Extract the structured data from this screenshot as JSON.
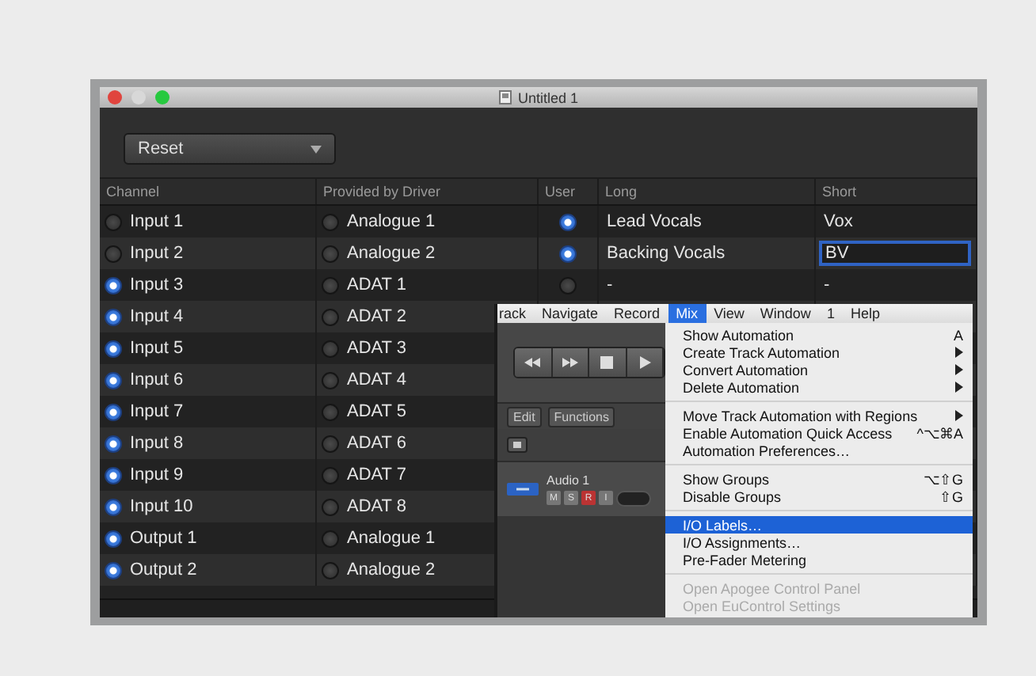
{
  "window": {
    "title": "Untitled 1",
    "controls": [
      {
        "color": "#e0443e"
      },
      {
        "color": "#d8d8d8"
      },
      {
        "color": "#27c93f"
      }
    ]
  },
  "toolbar": {
    "preset": "Reset"
  },
  "table": {
    "columns": [
      "Channel",
      "Provided by Driver",
      "User",
      "Long",
      "Short"
    ],
    "rows": [
      {
        "channel": "Input 1",
        "channel_selected": false,
        "driver": "Analogue 1",
        "driver_selected": false,
        "user_selected": true,
        "long": "Lead Vocals",
        "short": "Vox",
        "editing": false
      },
      {
        "channel": "Input 2",
        "channel_selected": false,
        "driver": "Analogue 2",
        "driver_selected": false,
        "user_selected": true,
        "long": "Backing Vocals",
        "short": "BV",
        "editing": true
      },
      {
        "channel": "Input 3",
        "channel_selected": true,
        "driver": "ADAT 1",
        "driver_selected": false,
        "user_selected": false,
        "long": "-",
        "short": "-",
        "editing": false
      },
      {
        "channel": "Input 4",
        "channel_selected": true,
        "driver": "ADAT 2",
        "driver_selected": false
      },
      {
        "channel": "Input 5",
        "channel_selected": true,
        "driver": "ADAT 3",
        "driver_selected": false
      },
      {
        "channel": "Input 6",
        "channel_selected": true,
        "driver": "ADAT 4",
        "driver_selected": false
      },
      {
        "channel": "Input 7",
        "channel_selected": true,
        "driver": "ADAT 5",
        "driver_selected": false
      },
      {
        "channel": "Input 8",
        "channel_selected": true,
        "driver": "ADAT 6",
        "driver_selected": false
      },
      {
        "channel": "Input 9",
        "channel_selected": true,
        "driver": "ADAT 7",
        "driver_selected": false
      },
      {
        "channel": "Input 10",
        "channel_selected": true,
        "driver": "ADAT 8",
        "driver_selected": false
      },
      {
        "channel": "Output 1",
        "channel_selected": true,
        "driver": "Analogue 1",
        "driver_selected": false
      },
      {
        "channel": "Output 2",
        "channel_selected": true,
        "driver": "Analogue 2",
        "driver_selected": false
      }
    ]
  },
  "logic": {
    "menubar": [
      {
        "label": "rack",
        "selected": false
      },
      {
        "label": "Navigate",
        "selected": false
      },
      {
        "label": "Record",
        "selected": false
      },
      {
        "label": "Mix",
        "selected": true
      },
      {
        "label": "View",
        "selected": false
      },
      {
        "label": "Window",
        "selected": false
      },
      {
        "label": "1",
        "selected": false
      },
      {
        "label": "Help",
        "selected": false
      }
    ],
    "edit_menu": "Edit",
    "functions_menu": "Functions",
    "track": {
      "name": "Audio 1",
      "buttons": [
        "M",
        "S",
        "R",
        "I"
      ]
    },
    "menu": [
      {
        "kind": "item",
        "label": "Show Automation",
        "shortcut": "A",
        "disabled": false,
        "selected": false
      },
      {
        "kind": "submenu",
        "label": "Create Track Automation",
        "disabled": false,
        "selected": false
      },
      {
        "kind": "submenu",
        "label": "Convert Automation",
        "disabled": false,
        "selected": false
      },
      {
        "kind": "submenu",
        "label": "Delete Automation",
        "disabled": false,
        "selected": false
      },
      {
        "kind": "separator"
      },
      {
        "kind": "submenu",
        "label": "Move Track Automation with Regions",
        "disabled": false,
        "selected": false
      },
      {
        "kind": "item",
        "label": "Enable Automation Quick Access",
        "shortcut": "^⌥⌘A",
        "disabled": false,
        "selected": false
      },
      {
        "kind": "item",
        "label": "Automation Preferences…",
        "disabled": false,
        "selected": false
      },
      {
        "kind": "separator"
      },
      {
        "kind": "item",
        "label": "Show Groups",
        "shortcut": "⌥⇧G",
        "disabled": false,
        "selected": false
      },
      {
        "kind": "item",
        "label": "Disable Groups",
        "shortcut": "⇧G",
        "disabled": false,
        "selected": false
      },
      {
        "kind": "separator"
      },
      {
        "kind": "item",
        "label": "I/O Labels…",
        "disabled": false,
        "selected": true
      },
      {
        "kind": "item",
        "label": "I/O Assignments…",
        "disabled": false,
        "selected": false
      },
      {
        "kind": "item",
        "label": "Pre-Fader Metering",
        "disabled": false,
        "selected": false
      },
      {
        "kind": "separator"
      },
      {
        "kind": "item",
        "label": "Open Apogee Control Panel",
        "disabled": true,
        "selected": false
      },
      {
        "kind": "item",
        "label": "Open EuControl Settings",
        "disabled": true,
        "selected": false
      }
    ]
  }
}
